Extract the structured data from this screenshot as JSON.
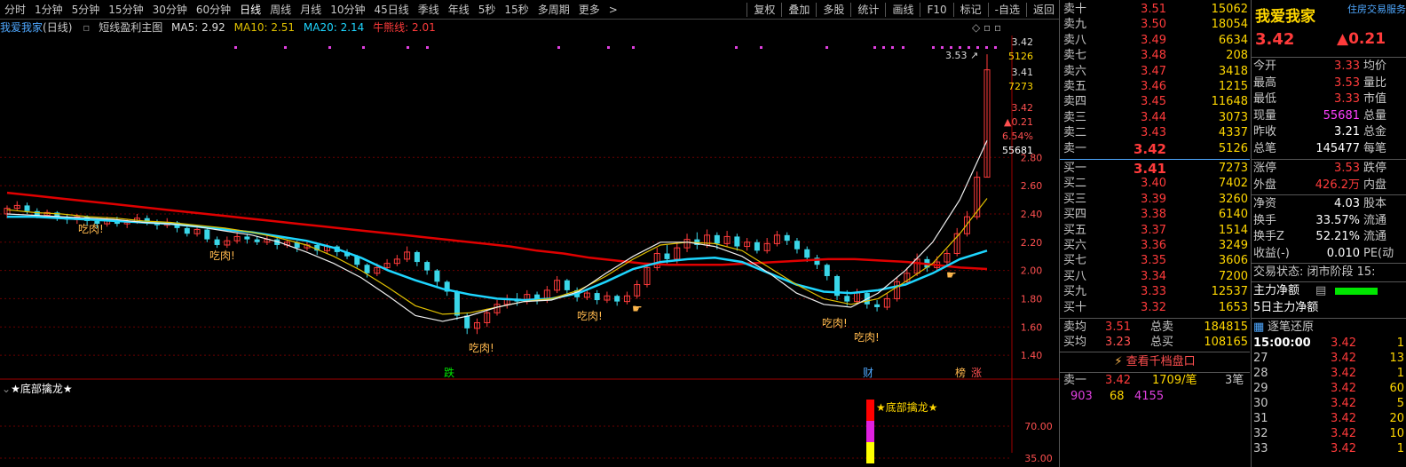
{
  "toolbar": {
    "periods": [
      "分时",
      "1分钟",
      "5分钟",
      "15分钟",
      "30分钟",
      "60分钟",
      "日线",
      "周线",
      "月线",
      "10分钟",
      "45日线",
      "季线",
      "年线",
      "5秒",
      "15秒",
      "多周期",
      "更多"
    ],
    "active_period": "日线",
    "more_arrow": ">",
    "actions": [
      "复权",
      "叠加",
      "多股",
      "统计",
      "画线",
      "F10",
      "标记",
      "-自选",
      "返回"
    ]
  },
  "infobar": {
    "stock": "我爱我家",
    "period": "(日线)",
    "indicator": "短线盈利主图",
    "ma5": "MA5: 2.92",
    "ma10": "MA10: 2.51",
    "ma20": "MA20: 2.14",
    "niu": "牛熊线: 2.01"
  },
  "colors": {
    "up": "#ff3b3b",
    "down": "#3ad6e8",
    "ma_red": "#e00000",
    "ma_cyan": "#1ed6ff",
    "ma_yellow": "#e0c000",
    "ma_white": "#f0f0f0",
    "label_orange": "#ffb84d",
    "grid": "#6a0000"
  },
  "chart_data": {
    "type": "candlestick",
    "y_ticks": [
      "2.80",
      "2.60",
      "2.40",
      "2.20",
      "2.00",
      "1.80",
      "1.60",
      "1.40"
    ],
    "ylim": [
      1.3,
      3.6
    ],
    "overlay_stack": [
      "3.42",
      "5126",
      "3.41",
      "7273",
      "3.42",
      "▲0.21",
      "6.54%",
      "55681"
    ],
    "high_marker": "3.53",
    "candles": [
      {
        "o": 2.4,
        "c": 2.44,
        "h": 2.46,
        "l": 2.37
      },
      {
        "o": 2.44,
        "c": 2.46,
        "h": 2.49,
        "l": 2.42
      },
      {
        "o": 2.46,
        "c": 2.42,
        "h": 2.48,
        "l": 2.4
      },
      {
        "o": 2.42,
        "c": 2.39,
        "h": 2.44,
        "l": 2.37
      },
      {
        "o": 2.39,
        "c": 2.41,
        "h": 2.43,
        "l": 2.37
      },
      {
        "o": 2.41,
        "c": 2.38,
        "h": 2.42,
        "l": 2.35
      },
      {
        "o": 2.38,
        "c": 2.36,
        "h": 2.4,
        "l": 2.33
      },
      {
        "o": 2.36,
        "c": 2.38,
        "h": 2.4,
        "l": 2.33
      },
      {
        "o": 2.38,
        "c": 2.35,
        "h": 2.39,
        "l": 2.32
      },
      {
        "o": 2.35,
        "c": 2.33,
        "h": 2.37,
        "l": 2.3
      },
      {
        "o": 2.33,
        "c": 2.36,
        "h": 2.38,
        "l": 2.31
      },
      {
        "o": 2.36,
        "c": 2.33,
        "h": 2.38,
        "l": 2.31
      },
      {
        "o": 2.33,
        "c": 2.34,
        "h": 2.36,
        "l": 2.3
      },
      {
        "o": 2.34,
        "c": 2.37,
        "h": 2.4,
        "l": 2.33
      },
      {
        "o": 2.37,
        "c": 2.34,
        "h": 2.39,
        "l": 2.32
      },
      {
        "o": 2.34,
        "c": 2.32,
        "h": 2.36,
        "l": 2.29
      },
      {
        "o": 2.32,
        "c": 2.34,
        "h": 2.37,
        "l": 2.3
      },
      {
        "o": 2.34,
        "c": 2.3,
        "h": 2.35,
        "l": 2.27
      },
      {
        "o": 2.3,
        "c": 2.26,
        "h": 2.31,
        "l": 2.24
      },
      {
        "o": 2.26,
        "c": 2.29,
        "h": 2.31,
        "l": 2.24
      },
      {
        "o": 2.29,
        "c": 2.22,
        "h": 2.3,
        "l": 2.2
      },
      {
        "o": 2.22,
        "c": 2.18,
        "h": 2.24,
        "l": 2.16
      },
      {
        "o": 2.18,
        "c": 2.21,
        "h": 2.24,
        "l": 2.16
      },
      {
        "o": 2.21,
        "c": 2.24,
        "h": 2.27,
        "l": 2.19
      },
      {
        "o": 2.24,
        "c": 2.22,
        "h": 2.26,
        "l": 2.19
      },
      {
        "o": 2.22,
        "c": 2.2,
        "h": 2.24,
        "l": 2.18
      },
      {
        "o": 2.2,
        "c": 2.22,
        "h": 2.25,
        "l": 2.18
      },
      {
        "o": 2.22,
        "c": 2.18,
        "h": 2.23,
        "l": 2.15
      },
      {
        "o": 2.18,
        "c": 2.2,
        "h": 2.22,
        "l": 2.16
      },
      {
        "o": 2.2,
        "c": 2.16,
        "h": 2.21,
        "l": 2.13
      },
      {
        "o": 2.16,
        "c": 2.18,
        "h": 2.2,
        "l": 2.14
      },
      {
        "o": 2.18,
        "c": 2.14,
        "h": 2.19,
        "l": 2.11
      },
      {
        "o": 2.14,
        "c": 2.17,
        "h": 2.19,
        "l": 2.12
      },
      {
        "o": 2.17,
        "c": 2.13,
        "h": 2.18,
        "l": 2.1
      },
      {
        "o": 2.13,
        "c": 2.1,
        "h": 2.15,
        "l": 2.08
      },
      {
        "o": 2.1,
        "c": 2.04,
        "h": 2.11,
        "l": 2.02
      },
      {
        "o": 2.04,
        "c": 1.98,
        "h": 2.05,
        "l": 1.95
      },
      {
        "o": 1.98,
        "c": 2.02,
        "h": 2.05,
        "l": 1.96
      },
      {
        "o": 2.02,
        "c": 2.05,
        "h": 2.08,
        "l": 2.0
      },
      {
        "o": 2.05,
        "c": 2.08,
        "h": 2.11,
        "l": 2.03
      },
      {
        "o": 2.08,
        "c": 2.13,
        "h": 2.17,
        "l": 2.06
      },
      {
        "o": 2.13,
        "c": 2.06,
        "h": 2.14,
        "l": 2.03
      },
      {
        "o": 2.06,
        "c": 2.0,
        "h": 2.07,
        "l": 1.97
      },
      {
        "o": 2.0,
        "c": 1.92,
        "h": 2.01,
        "l": 1.88
      },
      {
        "o": 1.92,
        "c": 1.85,
        "h": 1.93,
        "l": 1.82
      },
      {
        "o": 1.85,
        "c": 1.68,
        "h": 1.86,
        "l": 1.65
      },
      {
        "o": 1.68,
        "c": 1.59,
        "h": 1.7,
        "l": 1.55
      },
      {
        "o": 1.59,
        "c": 1.63,
        "h": 1.66,
        "l": 1.55
      },
      {
        "o": 1.63,
        "c": 1.7,
        "h": 1.73,
        "l": 1.6
      },
      {
        "o": 1.7,
        "c": 1.76,
        "h": 1.79,
        "l": 1.68
      },
      {
        "o": 1.76,
        "c": 1.8,
        "h": 1.83,
        "l": 1.73
      },
      {
        "o": 1.8,
        "c": 1.78,
        "h": 1.84,
        "l": 1.75
      },
      {
        "o": 1.78,
        "c": 1.83,
        "h": 1.86,
        "l": 1.76
      },
      {
        "o": 1.83,
        "c": 1.79,
        "h": 1.85,
        "l": 1.76
      },
      {
        "o": 1.79,
        "c": 1.86,
        "h": 1.89,
        "l": 1.77
      },
      {
        "o": 1.86,
        "c": 1.93,
        "h": 1.96,
        "l": 1.84
      },
      {
        "o": 1.93,
        "c": 1.86,
        "h": 1.94,
        "l": 1.83
      },
      {
        "o": 1.86,
        "c": 1.81,
        "h": 1.88,
        "l": 1.78
      },
      {
        "o": 1.81,
        "c": 1.84,
        "h": 1.87,
        "l": 1.79
      },
      {
        "o": 1.84,
        "c": 1.79,
        "h": 1.86,
        "l": 1.76
      },
      {
        "o": 1.79,
        "c": 1.82,
        "h": 1.85,
        "l": 1.77
      },
      {
        "o": 1.82,
        "c": 1.78,
        "h": 1.83,
        "l": 1.75
      },
      {
        "o": 1.78,
        "c": 1.82,
        "h": 1.85,
        "l": 1.76
      },
      {
        "o": 1.82,
        "c": 1.9,
        "h": 1.93,
        "l": 1.8
      },
      {
        "o": 1.9,
        "c": 2.02,
        "h": 2.05,
        "l": 1.88
      },
      {
        "o": 2.02,
        "c": 2.12,
        "h": 2.16,
        "l": 2.0
      },
      {
        "o": 2.12,
        "c": 2.08,
        "h": 2.18,
        "l": 2.05
      },
      {
        "o": 2.08,
        "c": 2.16,
        "h": 2.2,
        "l": 2.05
      },
      {
        "o": 2.16,
        "c": 2.22,
        "h": 2.26,
        "l": 2.13
      },
      {
        "o": 2.22,
        "c": 2.18,
        "h": 2.27,
        "l": 2.15
      },
      {
        "o": 2.18,
        "c": 2.25,
        "h": 2.29,
        "l": 2.16
      },
      {
        "o": 2.25,
        "c": 2.19,
        "h": 2.27,
        "l": 2.15
      },
      {
        "o": 2.19,
        "c": 2.24,
        "h": 2.28,
        "l": 2.17
      },
      {
        "o": 2.24,
        "c": 2.17,
        "h": 2.26,
        "l": 2.14
      },
      {
        "o": 2.17,
        "c": 2.2,
        "h": 2.23,
        "l": 2.14
      },
      {
        "o": 2.2,
        "c": 2.14,
        "h": 2.22,
        "l": 2.12
      },
      {
        "o": 2.14,
        "c": 2.19,
        "h": 2.23,
        "l": 2.12
      },
      {
        "o": 2.19,
        "c": 2.25,
        "h": 2.28,
        "l": 2.17
      },
      {
        "o": 2.25,
        "c": 2.21,
        "h": 2.27,
        "l": 2.18
      },
      {
        "o": 2.21,
        "c": 2.15,
        "h": 2.23,
        "l": 2.12
      },
      {
        "o": 2.15,
        "c": 2.09,
        "h": 2.17,
        "l": 2.06
      },
      {
        "o": 2.09,
        "c": 2.04,
        "h": 2.11,
        "l": 2.01
      },
      {
        "o": 2.04,
        "c": 1.96,
        "h": 2.05,
        "l": 1.93
      },
      {
        "o": 1.96,
        "c": 1.82,
        "h": 1.97,
        "l": 1.79
      },
      {
        "o": 1.82,
        "c": 1.78,
        "h": 1.86,
        "l": 1.75
      },
      {
        "o": 1.78,
        "c": 1.84,
        "h": 1.87,
        "l": 1.76
      },
      {
        "o": 1.84,
        "c": 1.76,
        "h": 1.85,
        "l": 1.73
      },
      {
        "o": 1.76,
        "c": 1.74,
        "h": 1.79,
        "l": 1.71
      },
      {
        "o": 1.74,
        "c": 1.8,
        "h": 1.84,
        "l": 1.72
      },
      {
        "o": 1.8,
        "c": 1.92,
        "h": 1.95,
        "l": 1.78
      },
      {
        "o": 1.92,
        "c": 1.98,
        "h": 2.02,
        "l": 1.9
      },
      {
        "o": 1.98,
        "c": 2.08,
        "h": 2.12,
        "l": 1.96
      },
      {
        "o": 2.08,
        "c": 2.02,
        "h": 2.1,
        "l": 1.99
      },
      {
        "o": 2.02,
        "c": 2.06,
        "h": 2.1,
        "l": 2.0
      },
      {
        "o": 2.06,
        "c": 2.12,
        "h": 2.15,
        "l": 2.04
      },
      {
        "o": 2.12,
        "c": 2.26,
        "h": 2.3,
        "l": 2.1
      },
      {
        "o": 2.26,
        "c": 2.38,
        "h": 2.42,
        "l": 2.24
      },
      {
        "o": 2.38,
        "c": 2.66,
        "h": 2.7,
        "l": 2.36
      },
      {
        "o": 2.66,
        "c": 3.42,
        "h": 3.53,
        "l": 2.66
      }
    ],
    "ma_red": [
      2.55,
      2.53,
      2.51,
      2.49,
      2.47,
      2.45,
      2.43,
      2.41,
      2.39,
      2.37,
      2.35,
      2.33,
      2.31,
      2.29,
      2.27,
      2.25,
      2.23,
      2.21,
      2.19,
      2.17,
      2.14,
      2.12,
      2.09,
      2.07,
      2.05,
      2.04,
      2.04,
      2.04,
      2.05,
      2.06,
      2.07,
      2.08,
      2.08,
      2.07,
      2.06,
      2.04,
      2.02,
      2.01
    ],
    "ma_cyan": [
      2.38,
      2.38,
      2.37,
      2.36,
      2.35,
      2.34,
      2.33,
      2.31,
      2.29,
      2.27,
      2.24,
      2.21,
      2.16,
      2.09,
      2.0,
      1.93,
      1.87,
      1.83,
      1.8,
      1.79,
      1.8,
      1.84,
      1.92,
      2.01,
      2.06,
      2.08,
      2.09,
      2.06,
      1.98,
      1.9,
      1.85,
      1.84,
      1.86,
      1.9,
      1.98,
      2.08,
      2.14
    ],
    "ma_yellow": [
      2.43,
      2.41,
      2.4,
      2.38,
      2.37,
      2.35,
      2.34,
      2.32,
      2.3,
      2.27,
      2.23,
      2.18,
      2.1,
      2.0,
      1.88,
      1.75,
      1.69,
      1.7,
      1.74,
      1.78,
      1.8,
      1.86,
      1.96,
      2.08,
      2.18,
      2.2,
      2.19,
      2.14,
      2.02,
      1.9,
      1.8,
      1.76,
      1.8,
      1.92,
      2.05,
      2.26,
      2.51
    ],
    "ma_white": [
      2.4,
      2.39,
      2.38,
      2.37,
      2.36,
      2.34,
      2.33,
      2.31,
      2.28,
      2.25,
      2.2,
      2.13,
      2.05,
      1.95,
      1.82,
      1.68,
      1.64,
      1.68,
      1.74,
      1.78,
      1.79,
      1.85,
      1.98,
      2.1,
      2.2,
      2.2,
      2.17,
      2.1,
      1.98,
      1.84,
      1.76,
      1.74,
      1.84,
      2.0,
      2.2,
      2.5,
      2.92
    ],
    "labels": [
      "吃肉!",
      "吃肉!",
      "吃肉!",
      "吃肉!",
      "吃肉!",
      "吃肉!"
    ],
    "markers": [
      "跌",
      "财",
      "榜",
      "涨"
    ],
    "sub_ticks": [
      "70.00",
      "35.00"
    ]
  },
  "sub_indicator": {
    "title": "★底部擒龙★",
    "label": "★底部擒龙★"
  },
  "orderbook": {
    "sell": [
      {
        "label": "卖十",
        "price": "3.51",
        "vol": "15062"
      },
      {
        "label": "卖九",
        "price": "3.50",
        "vol": "18054"
      },
      {
        "label": "卖八",
        "price": "3.49",
        "vol": "6634"
      },
      {
        "label": "卖七",
        "price": "3.48",
        "vol": "208"
      },
      {
        "label": "卖六",
        "price": "3.47",
        "vol": "3418"
      },
      {
        "label": "卖五",
        "price": "3.46",
        "vol": "1215"
      },
      {
        "label": "卖四",
        "price": "3.45",
        "vol": "11648"
      },
      {
        "label": "卖三",
        "price": "3.44",
        "vol": "3073"
      },
      {
        "label": "卖二",
        "price": "3.43",
        "vol": "4337"
      },
      {
        "label": "卖一",
        "price": "3.42",
        "vol": "5126"
      }
    ],
    "buy": [
      {
        "label": "买一",
        "price": "3.41",
        "vol": "7273"
      },
      {
        "label": "买二",
        "price": "3.40",
        "vol": "7402"
      },
      {
        "label": "买三",
        "price": "3.39",
        "vol": "3260"
      },
      {
        "label": "买四",
        "price": "3.38",
        "vol": "6140"
      },
      {
        "label": "买五",
        "price": "3.37",
        "vol": "1514"
      },
      {
        "label": "买六",
        "price": "3.36",
        "vol": "3249"
      },
      {
        "label": "买七",
        "price": "3.35",
        "vol": "3606"
      },
      {
        "label": "买八",
        "price": "3.34",
        "vol": "7200"
      },
      {
        "label": "买九",
        "price": "3.33",
        "vol": "12537"
      },
      {
        "label": "买十",
        "price": "3.32",
        "vol": "1653"
      }
    ],
    "avg_sell_label": "卖均",
    "avg_sell": "3.51",
    "total_sell_label": "总卖",
    "total_sell": "184815",
    "avg_buy_label": "买均",
    "avg_buy": "3.23",
    "total_buy_label": "总买",
    "total_buy": "108165",
    "thousand_btn": "查看千档盘口",
    "queue_label": "卖一",
    "queue_price": "3.42",
    "queue_size": "1709/笔",
    "queue_count": "3笔",
    "queue_vals": [
      "903",
      "68",
      "4155"
    ]
  },
  "quote": {
    "name": "我爱我家",
    "badge": "住房交易服务",
    "price": "3.42",
    "change": "▲0.21",
    "rows": [
      {
        "l": "今开",
        "v": "3.33",
        "l2": "均价",
        "c": "up"
      },
      {
        "l": "最高",
        "v": "3.53",
        "l2": "量比",
        "c": "up"
      },
      {
        "l": "最低",
        "v": "3.33",
        "l2": "市值",
        "c": "up"
      },
      {
        "l": "现量",
        "v": "55681",
        "l2": "总量",
        "c": "mg"
      },
      {
        "l": "昨收",
        "v": "3.21",
        "l2": "总金",
        "c": "wh"
      },
      {
        "l": "总笔",
        "v": "145477",
        "l2": "每笔",
        "c": "wh"
      }
    ],
    "rows2": [
      {
        "l": "涨停",
        "v": "3.53",
        "l2": "跌停",
        "c": "up"
      },
      {
        "l": "外盘",
        "v": "426.2万",
        "l2": "内盘",
        "c": "up"
      }
    ],
    "rows3": [
      {
        "l": "净资",
        "v": "4.03",
        "l2": "股本",
        "c": "wh"
      },
      {
        "l": "换手",
        "v": "33.57%",
        "l2": "流通",
        "c": "wh"
      },
      {
        "l": "换手Z",
        "v": "52.21%",
        "l2": "流通",
        "c": "wh"
      },
      {
        "l": "收益(-)",
        "v": "0.010",
        "l2": "PE(动",
        "c": "wh"
      }
    ],
    "status": "交易状态: 闭市阶段 15:",
    "main_flow": "主力净额",
    "flow5": "5日主力净额",
    "tick_title": "逐笔还原",
    "ticks": [
      {
        "t": "15:00:00",
        "p": "3.42",
        "v": "1"
      },
      {
        "t": "27",
        "p": "3.42",
        "v": "13"
      },
      {
        "t": "28",
        "p": "3.42",
        "v": "1"
      },
      {
        "t": "29",
        "p": "3.42",
        "v": "60"
      },
      {
        "t": "30",
        "p": "3.42",
        "v": "5"
      },
      {
        "t": "31",
        "p": "3.42",
        "v": "20"
      },
      {
        "t": "32",
        "p": "3.42",
        "v": "10"
      },
      {
        "t": "33",
        "p": "3.42",
        "v": "1"
      }
    ]
  }
}
